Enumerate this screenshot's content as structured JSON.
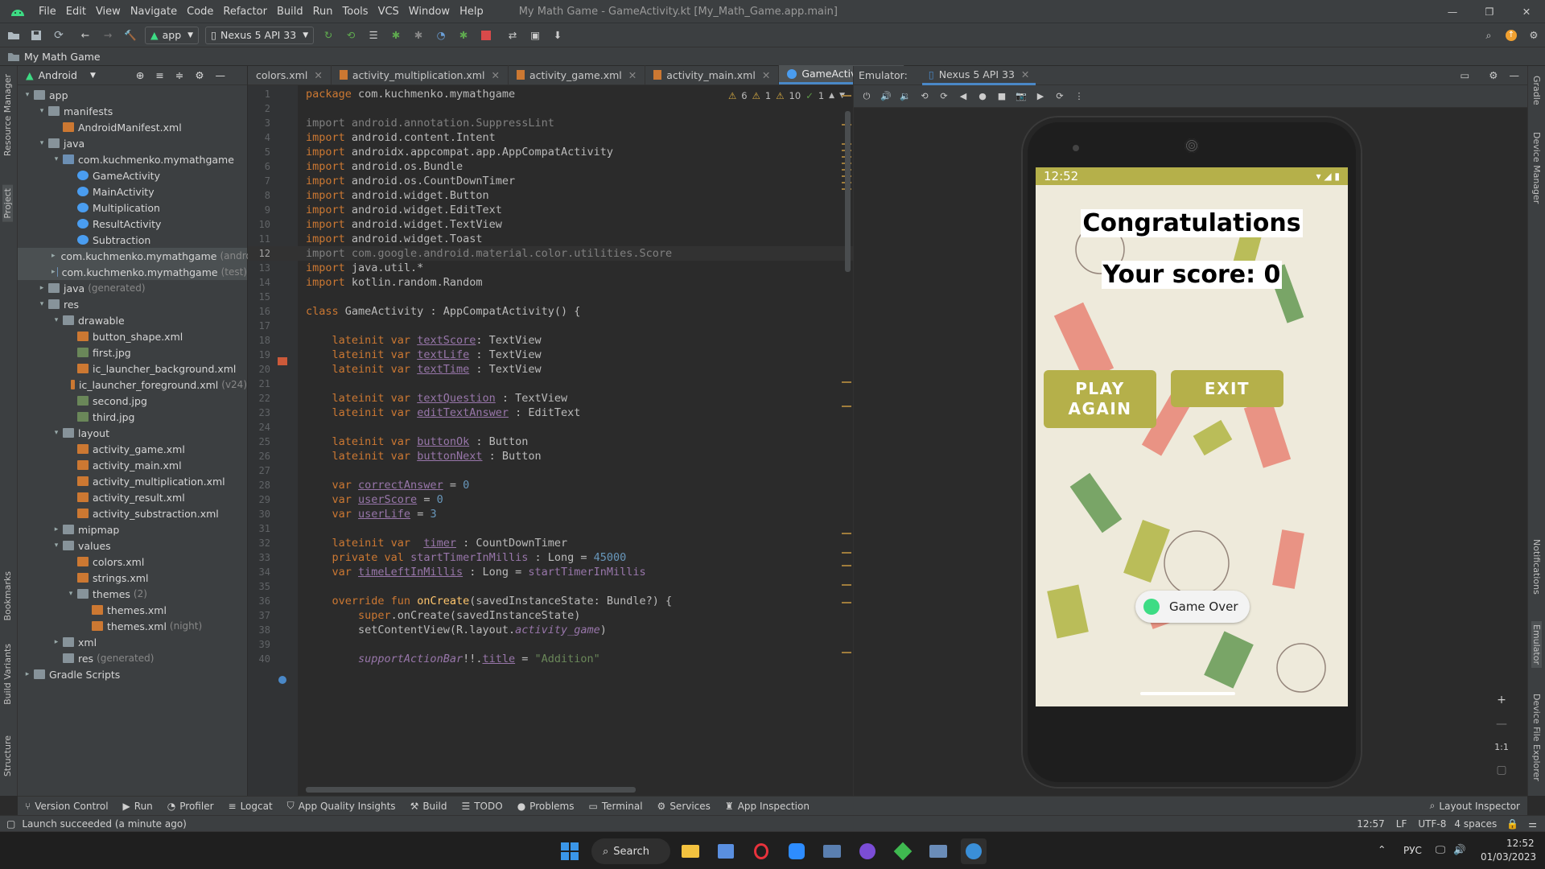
{
  "menubar": {
    "items": [
      "File",
      "Edit",
      "View",
      "Navigate",
      "Code",
      "Refactor",
      "Build",
      "Run",
      "Tools",
      "VCS",
      "Window",
      "Help"
    ],
    "window_title": "My Math Game - GameActivity.kt [My_Math_Game.app.main]"
  },
  "toolbar": {
    "run_config": "app",
    "device": "Nexus 5 API 33"
  },
  "navbar": {
    "breadcrumb": "My Math Game"
  },
  "left_strip": {
    "resource_manager": "Resource Manager",
    "project": "Project",
    "bookmarks": "Bookmarks",
    "build_variants": "Build Variants",
    "structure": "Structure"
  },
  "right_strip": {
    "gradle": "Gradle",
    "device_manager": "Device Manager",
    "notifications": "Notifications",
    "emulator": "Emulator",
    "device_file_explorer": "Device File Explorer"
  },
  "project": {
    "view_label": "Android",
    "tree": [
      {
        "label": "app",
        "indent": 0,
        "arrow": "▾",
        "icon": "fold"
      },
      {
        "label": "manifests",
        "indent": 1,
        "arrow": "▾",
        "icon": "fold"
      },
      {
        "label": "AndroidManifest.xml",
        "indent": 2,
        "arrow": "",
        "icon": "xmlf"
      },
      {
        "label": "java",
        "indent": 1,
        "arrow": "▾",
        "icon": "fold"
      },
      {
        "label": "com.kuchmenko.mymathgame",
        "indent": 2,
        "arrow": "▾",
        "icon": "pkg"
      },
      {
        "label": "GameActivity",
        "indent": 3,
        "arrow": "",
        "icon": "kt"
      },
      {
        "label": "MainActivity",
        "indent": 3,
        "arrow": "",
        "icon": "kt"
      },
      {
        "label": "Multiplication",
        "indent": 3,
        "arrow": "",
        "icon": "kt"
      },
      {
        "label": "ResultActivity",
        "indent": 3,
        "arrow": "",
        "icon": "kt"
      },
      {
        "label": "Subtraction",
        "indent": 3,
        "arrow": "",
        "icon": "kt"
      },
      {
        "label": "com.kuchmenko.mymathgame",
        "dim": "(andro",
        "indent": 2,
        "arrow": "▸",
        "icon": "pkg",
        "sel": true
      },
      {
        "label": "com.kuchmenko.mymathgame",
        "dim": "(test)",
        "indent": 2,
        "arrow": "▸",
        "icon": "pkg",
        "sel": true
      },
      {
        "label": "java",
        "dim": "(generated)",
        "indent": 1,
        "arrow": "▸",
        "icon": "fold"
      },
      {
        "label": "res",
        "indent": 1,
        "arrow": "▾",
        "icon": "fold"
      },
      {
        "label": "drawable",
        "indent": 2,
        "arrow": "▾",
        "icon": "fold"
      },
      {
        "label": "button_shape.xml",
        "indent": 3,
        "arrow": "",
        "icon": "xmlf"
      },
      {
        "label": "first.jpg",
        "indent": 3,
        "arrow": "",
        "icon": "img"
      },
      {
        "label": "ic_launcher_background.xml",
        "indent": 3,
        "arrow": "",
        "icon": "xmlf"
      },
      {
        "label": "ic_launcher_foreground.xml",
        "dim": "(v24)",
        "indent": 3,
        "arrow": "",
        "icon": "xmlf"
      },
      {
        "label": "second.jpg",
        "indent": 3,
        "arrow": "",
        "icon": "img"
      },
      {
        "label": "third.jpg",
        "indent": 3,
        "arrow": "",
        "icon": "img"
      },
      {
        "label": "layout",
        "indent": 2,
        "arrow": "▾",
        "icon": "fold"
      },
      {
        "label": "activity_game.xml",
        "indent": 3,
        "arrow": "",
        "icon": "xmlf"
      },
      {
        "label": "activity_main.xml",
        "indent": 3,
        "arrow": "",
        "icon": "xmlf"
      },
      {
        "label": "activity_multiplication.xml",
        "indent": 3,
        "arrow": "",
        "icon": "xmlf"
      },
      {
        "label": "activity_result.xml",
        "indent": 3,
        "arrow": "",
        "icon": "xmlf"
      },
      {
        "label": "activity_substraction.xml",
        "indent": 3,
        "arrow": "",
        "icon": "xmlf"
      },
      {
        "label": "mipmap",
        "indent": 2,
        "arrow": "▸",
        "icon": "fold"
      },
      {
        "label": "values",
        "indent": 2,
        "arrow": "▾",
        "icon": "fold"
      },
      {
        "label": "colors.xml",
        "indent": 3,
        "arrow": "",
        "icon": "xmlf"
      },
      {
        "label": "strings.xml",
        "indent": 3,
        "arrow": "",
        "icon": "xmlf"
      },
      {
        "label": "themes",
        "dim": "(2)",
        "indent": 3,
        "arrow": "▾",
        "icon": "fold"
      },
      {
        "label": "themes.xml",
        "indent": 4,
        "arrow": "",
        "icon": "xmlf"
      },
      {
        "label": "themes.xml",
        "dim": "(night)",
        "indent": 4,
        "arrow": "",
        "icon": "xmlf"
      },
      {
        "label": "xml",
        "indent": 2,
        "arrow": "▸",
        "icon": "fold"
      },
      {
        "label": "res",
        "dim": "(generated)",
        "indent": 2,
        "arrow": "",
        "icon": "fold"
      },
      {
        "label": "Gradle Scripts",
        "indent": 0,
        "arrow": "▸",
        "icon": "fold"
      }
    ]
  },
  "editor": {
    "tabs": [
      {
        "label": "colors.xml",
        "active": false
      },
      {
        "label": "activity_multiplication.xml",
        "active": false
      },
      {
        "label": "activity_game.xml",
        "active": false
      },
      {
        "label": "activity_main.xml",
        "active": false
      },
      {
        "label": "GameActivity.kt",
        "active": true
      }
    ],
    "inspections": {
      "warn_a": "6",
      "warn_b": "1",
      "weak": "10",
      "typo": "1"
    },
    "current_line": 12,
    "lines": [
      [
        [
          "kw",
          "package "
        ],
        [
          "",
          "com.kuchmenko.mymathgame"
        ]
      ],
      [],
      [
        [
          "grey",
          "import android.annotation.SuppressLint"
        ]
      ],
      [
        [
          "kw",
          "import "
        ],
        [
          "",
          "android.content.Intent"
        ]
      ],
      [
        [
          "kw",
          "import "
        ],
        [
          "",
          "androidx.appcompat.app.AppCompatActivity"
        ]
      ],
      [
        [
          "kw",
          "import "
        ],
        [
          "",
          "android.os.Bundle"
        ]
      ],
      [
        [
          "kw",
          "import "
        ],
        [
          "",
          "android.os.CountDownTimer"
        ]
      ],
      [
        [
          "kw",
          "import "
        ],
        [
          "",
          "android.widget.Button"
        ]
      ],
      [
        [
          "kw",
          "import "
        ],
        [
          "",
          "android.widget.EditText"
        ]
      ],
      [
        [
          "kw",
          "import "
        ],
        [
          "",
          "android.widget.TextView"
        ]
      ],
      [
        [
          "kw",
          "import "
        ],
        [
          "",
          "android.widget.Toast"
        ]
      ],
      [
        [
          "grey",
          "import com.google.android.material.color.utilities.Score"
        ]
      ],
      [
        [
          "kw",
          "import "
        ],
        [
          "",
          "java.util.*"
        ]
      ],
      [
        [
          "kw",
          "import "
        ],
        [
          "",
          "kotlin.random.Random"
        ]
      ],
      [],
      [
        [
          "kw",
          "class "
        ],
        [
          "",
          "GameActivity : AppCompatActivity() {"
        ]
      ],
      [],
      [
        [
          "",
          "    "
        ],
        [
          "kw",
          "lateinit var "
        ],
        [
          "prop under",
          "textScore"
        ],
        [
          "",
          ": TextView"
        ]
      ],
      [
        [
          "",
          "    "
        ],
        [
          "kw",
          "lateinit var "
        ],
        [
          "prop under",
          "textLife"
        ],
        [
          "",
          " : TextView"
        ]
      ],
      [
        [
          "",
          "    "
        ],
        [
          "kw",
          "lateinit var "
        ],
        [
          "prop under",
          "textTime"
        ],
        [
          "",
          " : TextView"
        ]
      ],
      [],
      [
        [
          "",
          "    "
        ],
        [
          "kw",
          "lateinit var "
        ],
        [
          "prop under",
          "textQuestion"
        ],
        [
          "",
          " : TextView"
        ]
      ],
      [
        [
          "",
          "    "
        ],
        [
          "kw",
          "lateinit var "
        ],
        [
          "prop under",
          "editTextAnswer"
        ],
        [
          "",
          " : EditText"
        ]
      ],
      [],
      [
        [
          "",
          "    "
        ],
        [
          "kw",
          "lateinit var "
        ],
        [
          "prop under",
          "buttonOk"
        ],
        [
          "",
          " : Button"
        ]
      ],
      [
        [
          "",
          "    "
        ],
        [
          "kw",
          "lateinit var "
        ],
        [
          "prop under",
          "buttonNext"
        ],
        [
          "",
          " : Button"
        ]
      ],
      [],
      [
        [
          "",
          "    "
        ],
        [
          "kw",
          "var "
        ],
        [
          "prop under",
          "correctAnswer"
        ],
        [
          "",
          " = "
        ],
        [
          "num",
          "0"
        ]
      ],
      [
        [
          "",
          "    "
        ],
        [
          "kw",
          "var "
        ],
        [
          "prop under",
          "userScore"
        ],
        [
          "",
          " = "
        ],
        [
          "num",
          "0"
        ]
      ],
      [
        [
          "",
          "    "
        ],
        [
          "kw",
          "var "
        ],
        [
          "prop under",
          "userLife"
        ],
        [
          "",
          " = "
        ],
        [
          "num",
          "3"
        ]
      ],
      [],
      [
        [
          "",
          "    "
        ],
        [
          "kw",
          "lateinit var  "
        ],
        [
          "prop under",
          "timer"
        ],
        [
          "",
          " : CountDownTimer"
        ]
      ],
      [
        [
          "",
          "    "
        ],
        [
          "kw",
          "private val "
        ],
        [
          "prop",
          "startTimerInMillis"
        ],
        [
          "",
          " : Long = "
        ],
        [
          "num",
          "45000"
        ]
      ],
      [
        [
          "",
          "    "
        ],
        [
          "kw",
          "var "
        ],
        [
          "prop under",
          "timeLeftInMillis"
        ],
        [
          "",
          " : Long = "
        ],
        [
          "prop",
          "startTimerInMillis"
        ]
      ],
      [],
      [
        [
          "",
          "    "
        ],
        [
          "kw",
          "override fun "
        ],
        [
          "fn",
          "onCreate"
        ],
        [
          "",
          "(savedInstanceState: Bundle?) {"
        ]
      ],
      [
        [
          "",
          "        "
        ],
        [
          "kw",
          "super"
        ],
        [
          "",
          ".onCreate(savedInstanceState)"
        ]
      ],
      [
        [
          "",
          "        "
        ],
        [
          "",
          "setContentView(R.layout."
        ],
        [
          "prop ital",
          "activity_game"
        ],
        [
          "",
          ")"
        ]
      ],
      [],
      [
        [
          "",
          "        "
        ],
        [
          "prop ital",
          "supportActionBar"
        ],
        [
          "",
          "!!."
        ],
        [
          "prop under",
          "title"
        ],
        [
          "",
          " = "
        ],
        [
          "str",
          "\"Addition\""
        ]
      ]
    ]
  },
  "emulator": {
    "header_label": "Emulator:",
    "device_tab": "Nexus 5 API 33",
    "phone": {
      "time": "12:52",
      "title": "Congratulations",
      "score": "Your score: 0",
      "play_again": "PLAY AGAIN",
      "exit": "EXIT",
      "toast": "Game Over"
    },
    "zoom_ratio": "1:1"
  },
  "toolwindows": [
    "Version Control",
    "Run",
    "Profiler",
    "Logcat",
    "App Quality Insights",
    "Build",
    "TODO",
    "Problems",
    "Terminal",
    "Services",
    "App Inspection"
  ],
  "layout_inspector": "Layout Inspector",
  "statusbar": {
    "message": "Launch succeeded (a minute ago)",
    "position": "12:57",
    "line_sep": "LF",
    "encoding": "UTF-8",
    "indent": "4 spaces"
  },
  "taskbar": {
    "search": "Search",
    "lang": "РУС",
    "time": "12:52",
    "date": "01/03/2023"
  },
  "colors": {
    "accent": "#4a88c7",
    "phone_olive": "#b5b04a"
  }
}
